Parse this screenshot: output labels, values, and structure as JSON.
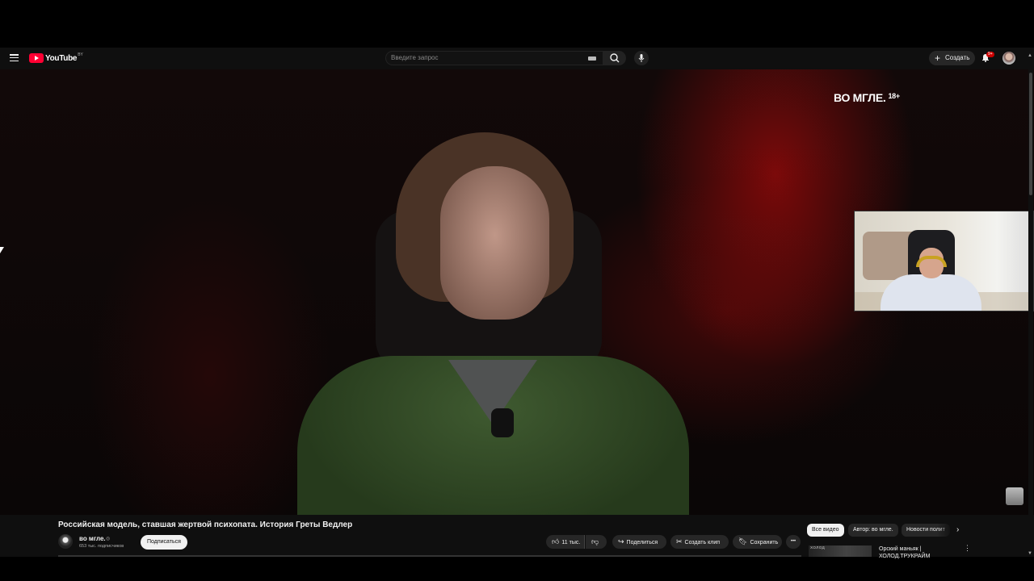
{
  "header": {
    "logo_text": "YouTube",
    "logo_region": "BY",
    "search_placeholder": "Введите запрос",
    "create_label": "Создать",
    "notification_count": "9+",
    "icons": [
      "menu-icon",
      "keyboard-icon",
      "search-icon",
      "mic-icon",
      "plus-icon",
      "bell-icon"
    ]
  },
  "video": {
    "watermark": "ВО МГЛЕ.",
    "age_rating": "18+"
  },
  "details": {
    "title": "Российская модель, ставшая жертвой психопата. История Греты Ведлер",
    "channel_name": "во мгле.",
    "verified_mark": "◎",
    "subscribers": "653 тыс. подписчиков",
    "subscribe_label": "Подписаться",
    "like_count": "11 тыс.",
    "share_label": "Поделиться",
    "clip_label": "Создать клип",
    "save_label": "Сохранить",
    "more_label": "•••"
  },
  "sidebar": {
    "chips": [
      "Все видео",
      "Автор: во мгле.",
      "Новости полит"
    ],
    "recommendation": {
      "thumb_text": "ХОЛОД",
      "title_line1": "Орский маньяк |",
      "title_line2": "ХОЛОД.ТРУКРАЙМ"
    }
  },
  "colors": {
    "background": "#0f0f0f",
    "brand_red": "#ff0033",
    "chip_bg": "#272727",
    "text": "#f1f1f1"
  }
}
